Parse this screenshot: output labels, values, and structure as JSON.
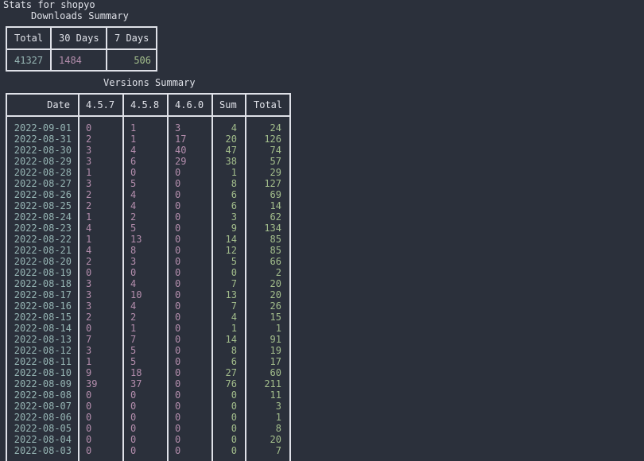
{
  "title": "Stats for shopyo",
  "downloads_summary": {
    "caption": "Downloads Summary",
    "headers": [
      "Total",
      "30 Days",
      "7 Days"
    ],
    "values": [
      "41327",
      "1484",
      "506"
    ]
  },
  "versions_summary": {
    "caption": "Versions Summary",
    "headers": [
      "Date",
      "4.5.7",
      "4.5.8",
      "4.6.0",
      "Sum",
      "Total"
    ],
    "rows": [
      [
        "2022-09-01",
        "0",
        "1",
        "3",
        "4",
        "24"
      ],
      [
        "2022-08-31",
        "2",
        "1",
        "17",
        "20",
        "126"
      ],
      [
        "2022-08-30",
        "3",
        "4",
        "40",
        "47",
        "74"
      ],
      [
        "2022-08-29",
        "3",
        "6",
        "29",
        "38",
        "57"
      ],
      [
        "2022-08-28",
        "1",
        "0",
        "0",
        "1",
        "29"
      ],
      [
        "2022-08-27",
        "3",
        "5",
        "0",
        "8",
        "127"
      ],
      [
        "2022-08-26",
        "2",
        "4",
        "0",
        "6",
        "69"
      ],
      [
        "2022-08-25",
        "2",
        "4",
        "0",
        "6",
        "14"
      ],
      [
        "2022-08-24",
        "1",
        "2",
        "0",
        "3",
        "62"
      ],
      [
        "2022-08-23",
        "4",
        "5",
        "0",
        "9",
        "134"
      ],
      [
        "2022-08-22",
        "1",
        "13",
        "0",
        "14",
        "85"
      ],
      [
        "2022-08-21",
        "4",
        "8",
        "0",
        "12",
        "85"
      ],
      [
        "2022-08-20",
        "2",
        "3",
        "0",
        "5",
        "66"
      ],
      [
        "2022-08-19",
        "0",
        "0",
        "0",
        "0",
        "2"
      ],
      [
        "2022-08-18",
        "3",
        "4",
        "0",
        "7",
        "20"
      ],
      [
        "2022-08-17",
        "3",
        "10",
        "0",
        "13",
        "20"
      ],
      [
        "2022-08-16",
        "3",
        "4",
        "0",
        "7",
        "26"
      ],
      [
        "2022-08-15",
        "2",
        "2",
        "0",
        "4",
        "15"
      ],
      [
        "2022-08-14",
        "0",
        "1",
        "0",
        "1",
        "1"
      ],
      [
        "2022-08-13",
        "7",
        "7",
        "0",
        "14",
        "91"
      ],
      [
        "2022-08-12",
        "3",
        "5",
        "0",
        "8",
        "19"
      ],
      [
        "2022-08-11",
        "1",
        "5",
        "0",
        "6",
        "17"
      ],
      [
        "2022-08-10",
        "9",
        "18",
        "0",
        "27",
        "60"
      ],
      [
        "2022-08-09",
        "39",
        "37",
        "0",
        "76",
        "211"
      ],
      [
        "2022-08-08",
        "0",
        "0",
        "0",
        "0",
        "11"
      ],
      [
        "2022-08-07",
        "0",
        "0",
        "0",
        "0",
        "3"
      ],
      [
        "2022-08-06",
        "0",
        "0",
        "0",
        "0",
        "1"
      ],
      [
        "2022-08-05",
        "0",
        "0",
        "0",
        "0",
        "8"
      ],
      [
        "2022-08-04",
        "0",
        "0",
        "0",
        "0",
        "20"
      ],
      [
        "2022-08-03",
        "0",
        "0",
        "0",
        "0",
        "7"
      ]
    ]
  },
  "colors": {
    "background": "#2b303b",
    "border": "#dfe1e8",
    "date": "#96b5b4",
    "version": "#b48ead",
    "sum": "#a3be8c"
  }
}
